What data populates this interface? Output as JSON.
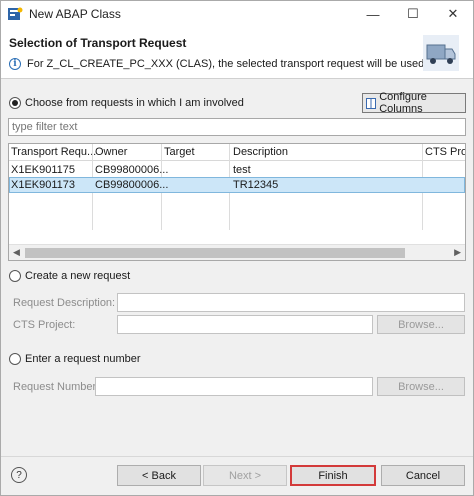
{
  "window": {
    "title": "New ABAP Class"
  },
  "window_controls": {
    "minimize": "—",
    "maximize": "☐",
    "close": "✕"
  },
  "header": {
    "title": "Selection of Transport Request",
    "info_icon": "i",
    "message": "For Z_CL_CREATE_PC_XXX (CLAS), the selected transport request will be used"
  },
  "involved": {
    "label": "Choose from requests in which I am involved",
    "configure_label": "Configure Columns",
    "filter_placeholder": "type filter text"
  },
  "table": {
    "headers": [
      "Transport Requ...",
      "Owner",
      "Target",
      "Description",
      "CTS Proje"
    ],
    "rows": [
      {
        "request": "X1EK901175",
        "owner": "CB99800006...",
        "target": "",
        "description": "test",
        "cts": ""
      },
      {
        "request": "X1EK901173",
        "owner": "CB99800006...",
        "target": "",
        "description": "TR12345",
        "cts": ""
      }
    ],
    "selected_index": 1
  },
  "new_request": {
    "label": "Create a new request",
    "description_label": "Request Description: *",
    "description_value": "",
    "cts_label": "CTS Project:",
    "cts_value": "",
    "browse_label": "Browse..."
  },
  "enter_request": {
    "label": "Enter a request number",
    "number_label": "Request Number:",
    "number_value": "",
    "browse_label": "Browse..."
  },
  "footer": {
    "help": "?",
    "back": "< Back",
    "next": "Next >",
    "finish": "Finish",
    "cancel": "Cancel"
  },
  "colors": {
    "selected_row": "#cce6f8",
    "default_button_border": "#d33a3a",
    "accent": "#2b6fb6"
  }
}
